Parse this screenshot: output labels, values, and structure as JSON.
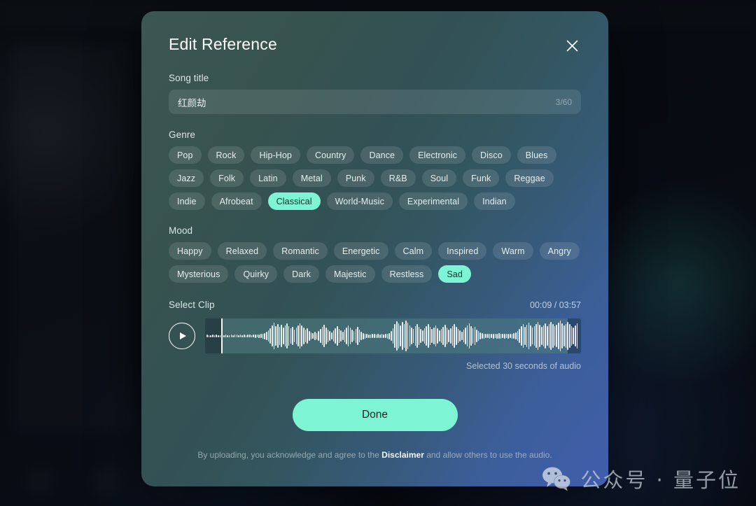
{
  "modal": {
    "title": "Edit Reference",
    "close_icon": "close-icon"
  },
  "song_title": {
    "label": "Song title",
    "value": "红颜劫",
    "placeholder": "Song title",
    "counter": "3/60"
  },
  "genre": {
    "label": "Genre",
    "selected": "Classical",
    "options": [
      "Pop",
      "Rock",
      "Hip-Hop",
      "Country",
      "Dance",
      "Electronic",
      "Disco",
      "Blues",
      "Jazz",
      "Folk",
      "Latin",
      "Metal",
      "Punk",
      "R&B",
      "Soul",
      "Funk",
      "Reggae",
      "Indie",
      "Afrobeat",
      "Classical",
      "World-Music",
      "Experimental",
      "Indian"
    ]
  },
  "mood": {
    "label": "Mood",
    "selected": "Sad",
    "options": [
      "Happy",
      "Relaxed",
      "Romantic",
      "Energetic",
      "Calm",
      "Inspired",
      "Warm",
      "Angry",
      "Mysterious",
      "Quirky",
      "Dark",
      "Majestic",
      "Restless",
      "Sad"
    ]
  },
  "clip": {
    "label": "Select Clip",
    "current_time": "00:09",
    "total_time": "03:57",
    "time_display": "00:09 / 03:57",
    "note": "Selected 30 seconds of audio",
    "play_icon": "play-icon",
    "selection_start_pct": 4.2,
    "selection_end_pct": 96.4,
    "playhead_pct": 4.2,
    "waveform_amplitudes": [
      4,
      3,
      3,
      4,
      3,
      4,
      3,
      3,
      4,
      3,
      4,
      3,
      3,
      4,
      3,
      4,
      4,
      3,
      4,
      3,
      4,
      3,
      4,
      4,
      3,
      4,
      5,
      4,
      5,
      6,
      7,
      9,
      12,
      16,
      22,
      30,
      38,
      28,
      34,
      26,
      32,
      24,
      30,
      36,
      28,
      22,
      26,
      18,
      24,
      30,
      36,
      30,
      24,
      18,
      22,
      14,
      10,
      8,
      12,
      9,
      14,
      20,
      26,
      32,
      24,
      18,
      14,
      10,
      16,
      22,
      28,
      20,
      16,
      12,
      18,
      24,
      30,
      24,
      18,
      14,
      20,
      26,
      18,
      12,
      9,
      7,
      6,
      5,
      5,
      6,
      6,
      5,
      6,
      5,
      6,
      5,
      6,
      7,
      9,
      14,
      22,
      34,
      42,
      36,
      30,
      40,
      34,
      44,
      38,
      30,
      24,
      20,
      28,
      34,
      26,
      20,
      16,
      22,
      28,
      34,
      26,
      20,
      24,
      30,
      22,
      16,
      20,
      26,
      32,
      24,
      18,
      22,
      28,
      34,
      26,
      20,
      16,
      12,
      18,
      24,
      30,
      36,
      28,
      22,
      26,
      18,
      14,
      10,
      8,
      7,
      6,
      6,
      7,
      6,
      7,
      6,
      7,
      8,
      7,
      6,
      7,
      6,
      7,
      6,
      7,
      8,
      10,
      14,
      20,
      28,
      34,
      26,
      32,
      38,
      30,
      24,
      28,
      34,
      40,
      32,
      26,
      30,
      36,
      28,
      34,
      40,
      34,
      28,
      32,
      38,
      44,
      36,
      30,
      34,
      40,
      34,
      28,
      24,
      30,
      36
    ]
  },
  "footer": {
    "done_label": "Done",
    "disclaimer_prefix": "By uploading, you acknowledge and agree to the ",
    "disclaimer_link": "Disclaimer",
    "disclaimer_suffix": " and allow others to use the audio."
  },
  "watermark": {
    "text": "公众号 · 量子位",
    "icon": "wechat-icon"
  }
}
